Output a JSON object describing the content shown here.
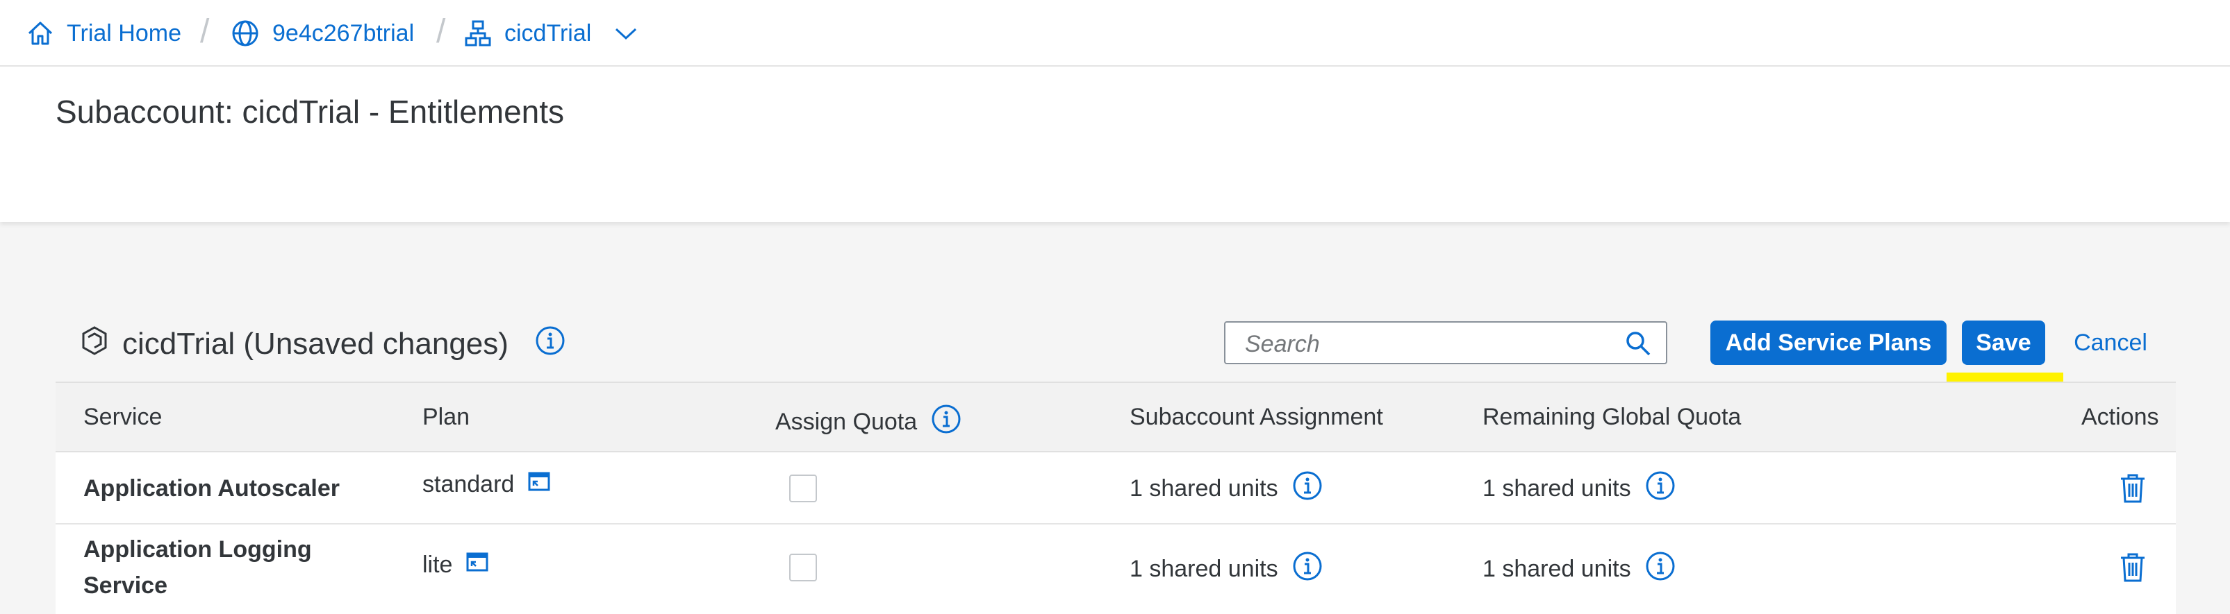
{
  "breadcrumb": {
    "home": "Trial Home",
    "global_account": "9e4c267btrial",
    "subaccount": "cicdTrial",
    "separator": "/"
  },
  "header": {
    "title": "Subaccount: cicdTrial - Entitlements"
  },
  "section": {
    "title": "cicdTrial (Unsaved changes)"
  },
  "toolbar": {
    "search_placeholder": "Search",
    "add_label": "Add Service Plans",
    "save_label": "Save",
    "cancel_label": "Cancel"
  },
  "table": {
    "columns": [
      "Service",
      "Plan",
      "Assign Quota",
      "Subaccount Assignment",
      "Remaining Global Quota",
      "Actions"
    ],
    "rows": [
      {
        "service": "Application Autoscaler",
        "plan": "standard",
        "assign_quota": false,
        "subaccount_assignment": "1 shared units",
        "remaining_global_quota": "1 shared units"
      },
      {
        "service": "Application Logging Service",
        "plan": "lite",
        "assign_quota": false,
        "subaccount_assignment": "1 shared units",
        "remaining_global_quota": "1 shared units"
      }
    ]
  },
  "icons": {
    "home": "home-icon",
    "globe": "globe-icon",
    "hierarchy": "hierarchy-icon",
    "chevron": "chevron-down-icon",
    "info": "info-icon",
    "search": "search-icon",
    "plan_detail": "plan-detail-icon",
    "delete": "trash-icon",
    "subaccount": "subaccount-icon"
  },
  "colors": {
    "accent": "#0a6ed1",
    "highlight": "#fff200",
    "background": "#f5f5f5"
  }
}
